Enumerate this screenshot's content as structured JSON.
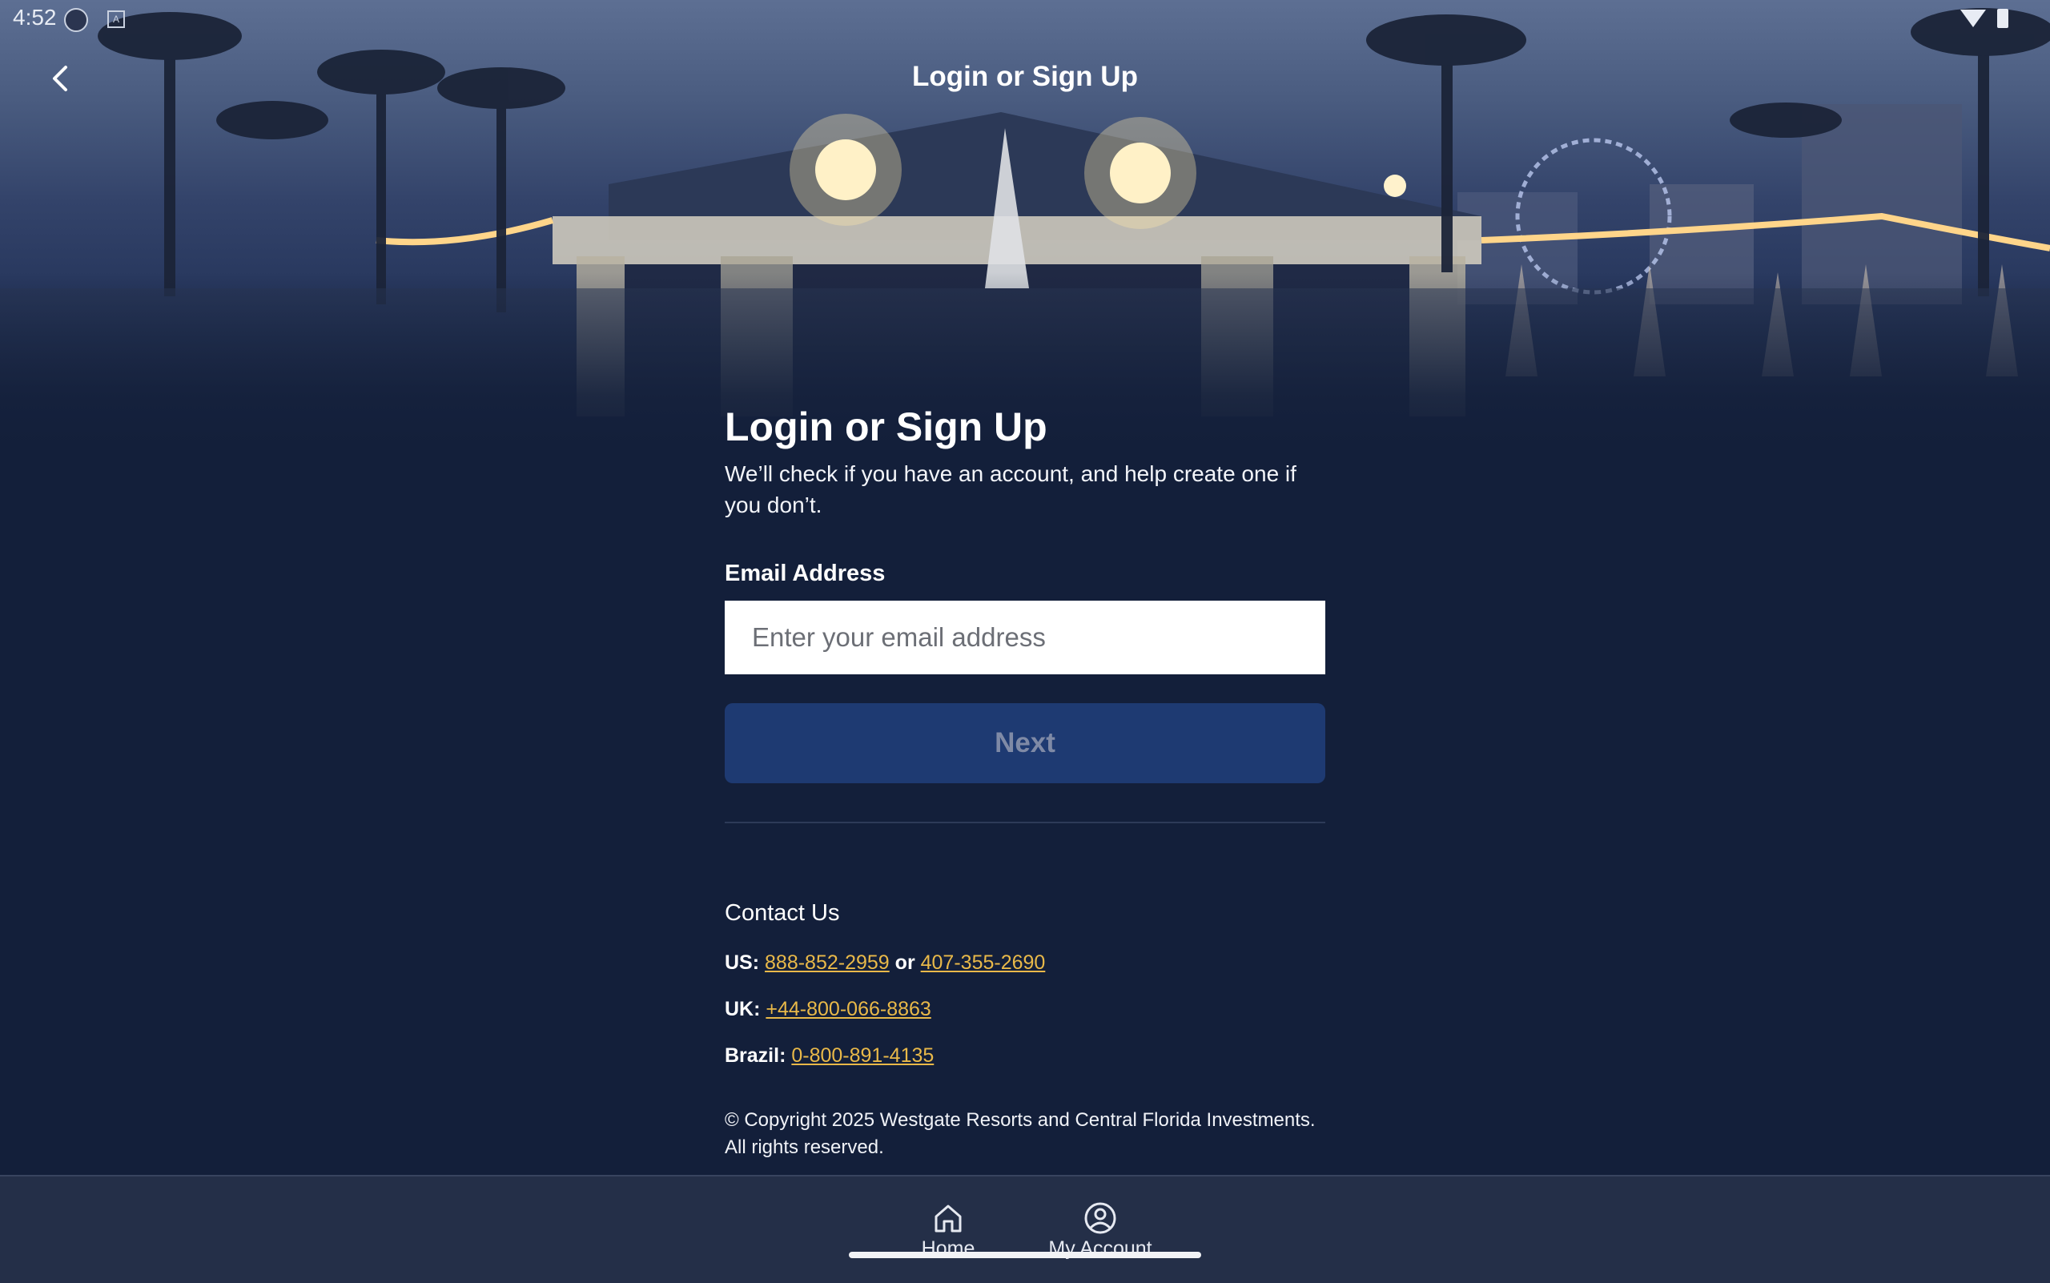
{
  "status_bar": {
    "time": "4:52",
    "icons": [
      "media-icon",
      "keyboard-icon",
      "wifi-icon",
      "battery-icon"
    ]
  },
  "top_bar": {
    "title": "Login or Sign Up",
    "back_icon": "chevron-left-icon"
  },
  "main": {
    "title": "Login or Sign Up",
    "subtitle": "We’ll check if you have an account, and help create one if you don’t.",
    "email_label": "Email Address",
    "email_placeholder": "Enter your email address",
    "email_value": "",
    "next_label": "Next"
  },
  "contact": {
    "heading": "Contact Us",
    "us_label": "US:",
    "us_phone_1": "888-852-2959",
    "us_or": "or",
    "us_phone_2": "407-355-2690",
    "uk_label": "UK:",
    "uk_phone": "+44-800-066-8863",
    "brazil_label": "Brazil:",
    "brazil_phone": "0-800-891-4135",
    "link_color": "#e9b949"
  },
  "copyright": "© Copyright 2025 Westgate Resorts and Central Florida Investments. All rights reserved.",
  "bottom_nav": {
    "items": [
      {
        "label": "Home",
        "icon": "home-icon"
      },
      {
        "label": "My Account",
        "icon": "account-circle-icon"
      }
    ]
  },
  "colors": {
    "background": "#131f3a",
    "button": "#1e3a72",
    "nav_background": "#242f48"
  }
}
